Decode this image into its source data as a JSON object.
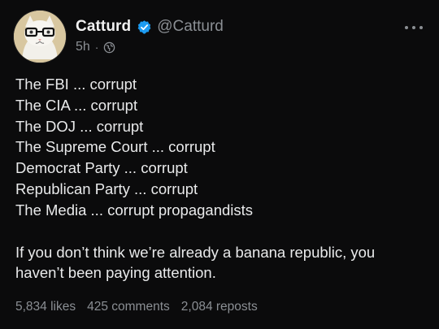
{
  "author": {
    "display_name": "Catturd",
    "handle": "@Catturd",
    "verified": true,
    "avatar": "cat-with-glasses-avatar"
  },
  "post": {
    "time": "5h",
    "separator": "·",
    "visibility_icon": "globe-icon",
    "more_icon": "more-options-icon",
    "lines": [
      "The FBI ... corrupt",
      "The CIA ... corrupt",
      "The DOJ ... corrupt",
      "The Supreme Court ... corrupt",
      "Democrat Party ... corrupt",
      "Republican Party ... corrupt",
      "The Media ... corrupt propagandists"
    ],
    "closing_line_1": "If you don’t think we’re already a banana republic, you",
    "closing_line_2": "haven’t been paying attention."
  },
  "stats": {
    "likes": "5,834 likes",
    "comments": "425 comments",
    "reposts": "2,084 reposts"
  },
  "colors": {
    "background": "#0b0b0c",
    "text": "#e9eaeb",
    "muted": "#8b8f94",
    "verified_badge": "#1d9bf0"
  }
}
